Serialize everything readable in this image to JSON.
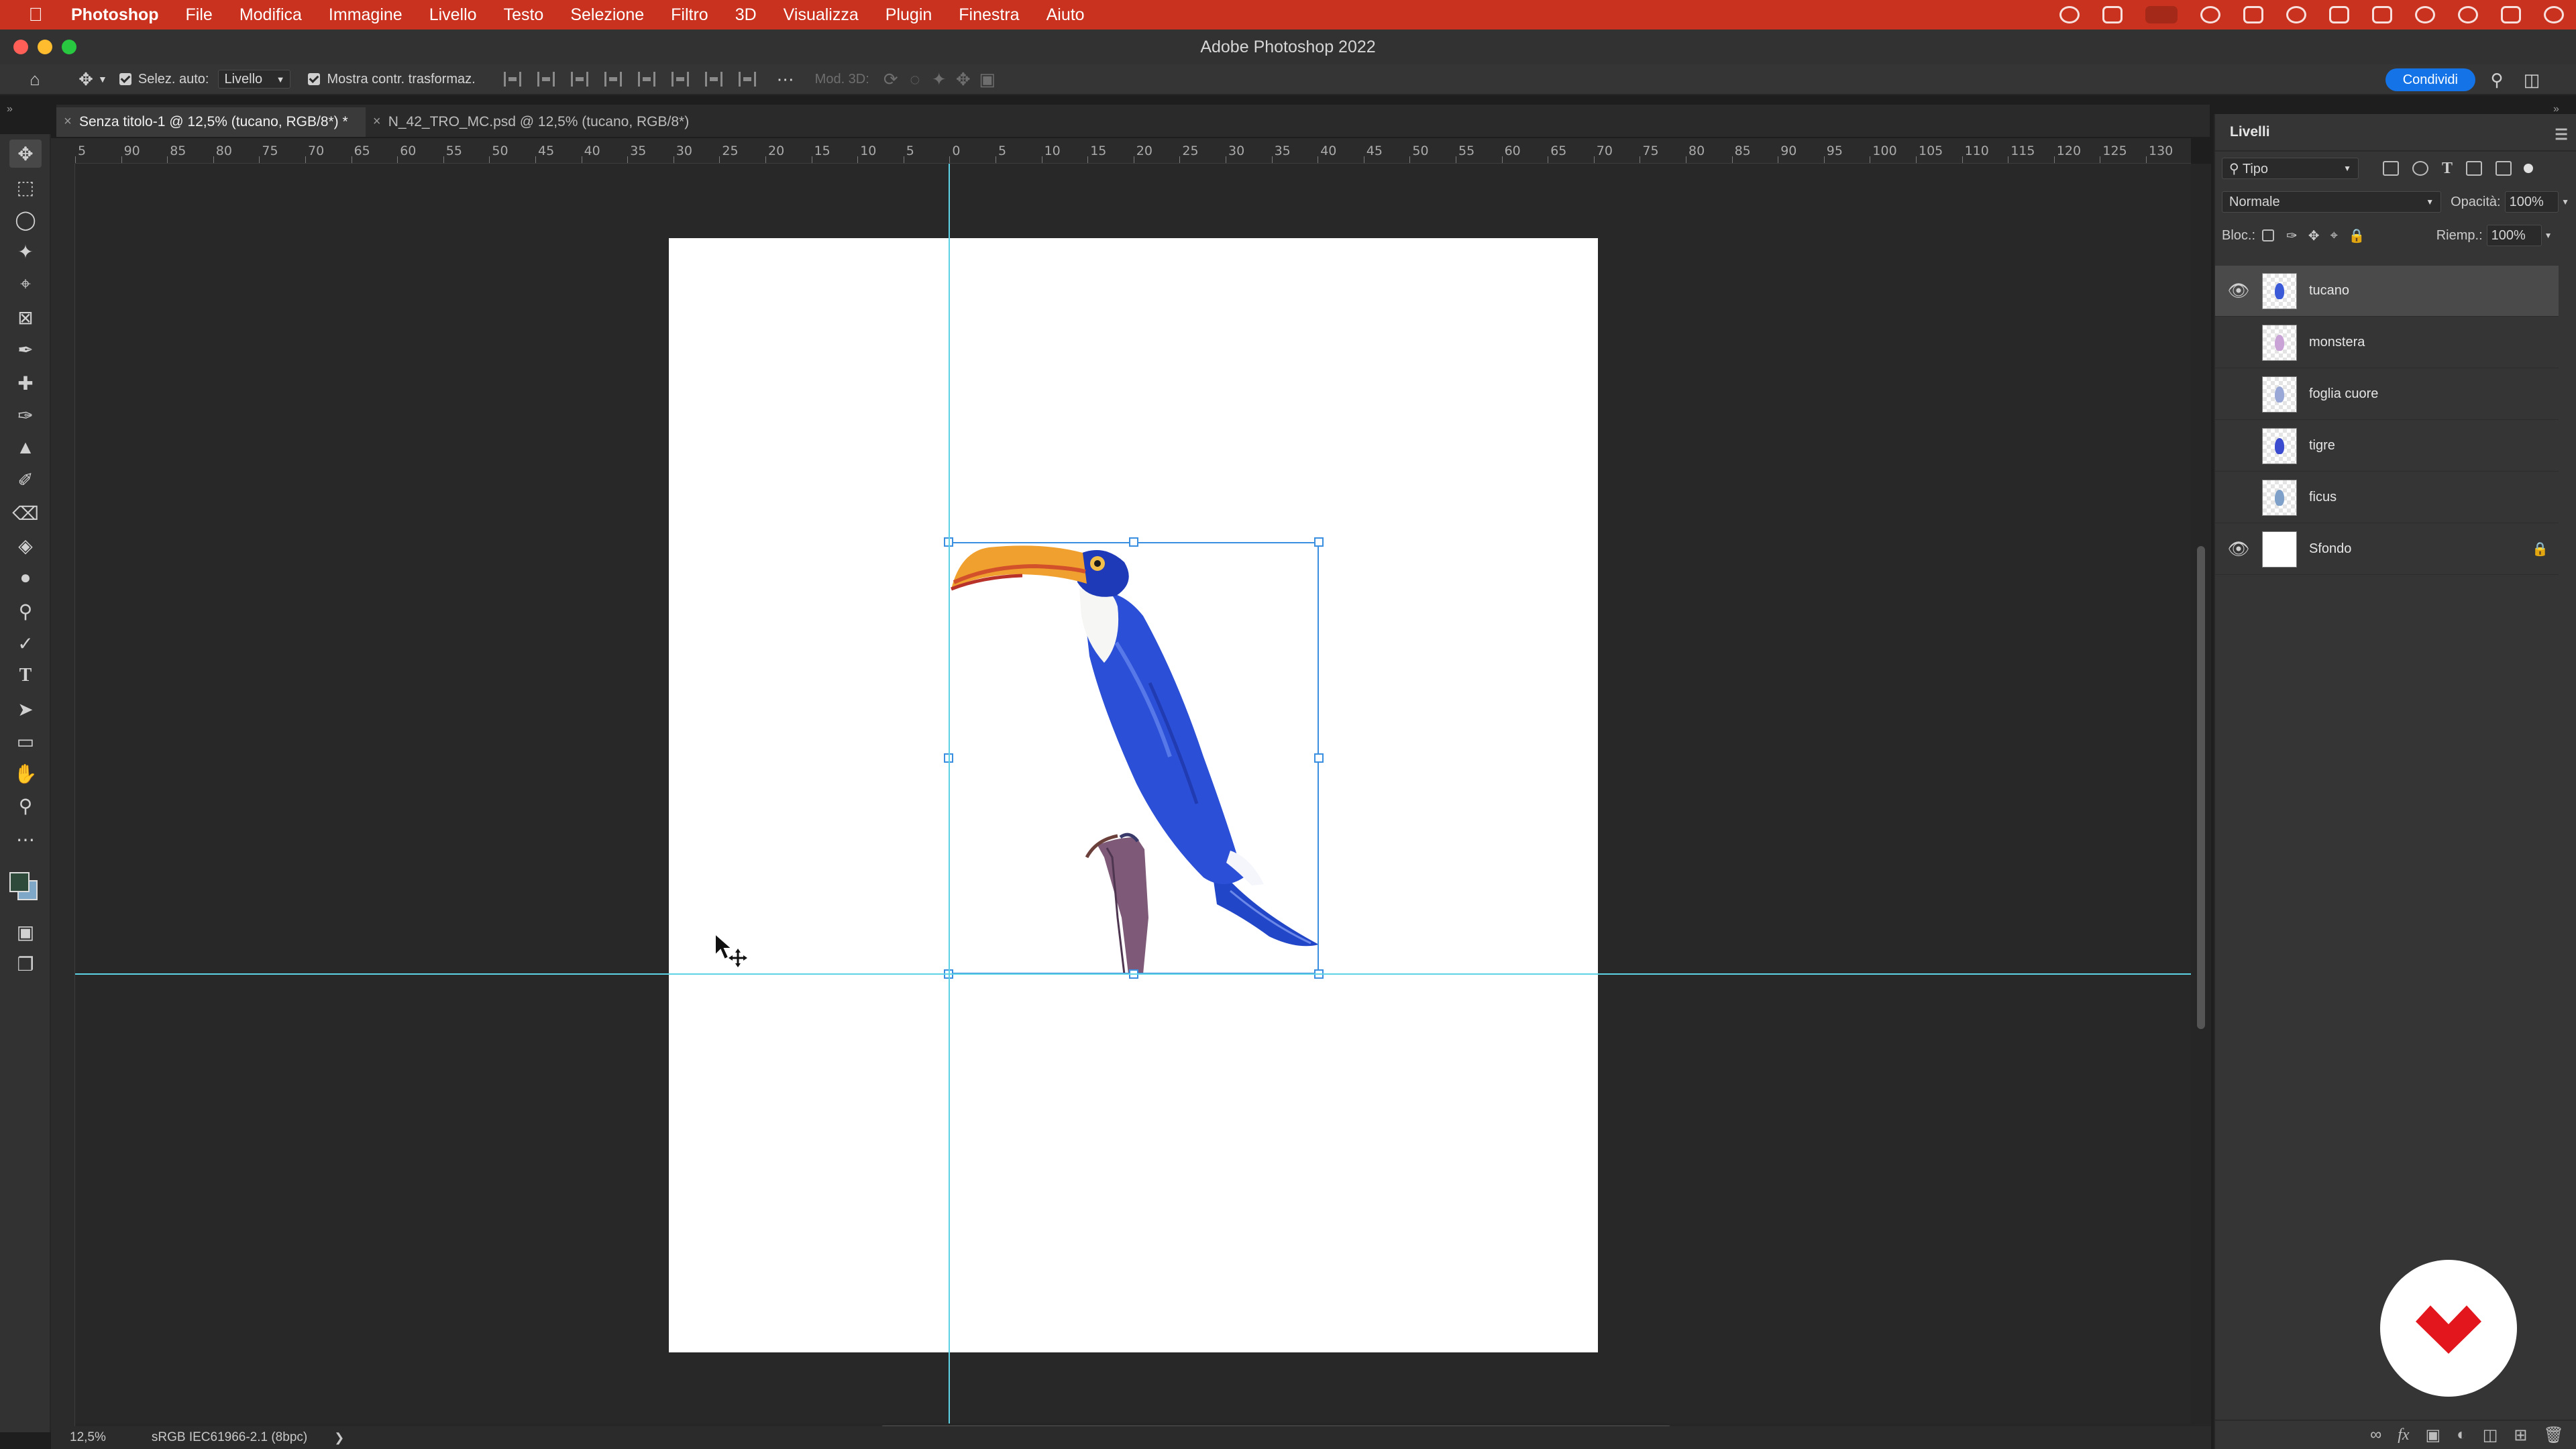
{
  "menubar": {
    "app": "Photoshop",
    "items": [
      "File",
      "Modifica",
      "Immagine",
      "Livello",
      "Testo",
      "Selezione",
      "Filtro",
      "3D",
      "Visualizza",
      "Plugin",
      "Finestra",
      "Aiuto"
    ]
  },
  "window": {
    "title": "Adobe Photoshop 2022"
  },
  "options": {
    "auto_select_label": "Selez. auto:",
    "auto_select_value": "Livello",
    "show_transform_label": "Mostra contr. trasformaz.",
    "mode3d_label": "Mod. 3D:",
    "share_label": "Condividi"
  },
  "doc_tabs": [
    {
      "label": "Senza titolo-1 @ 12,5% (tucano, RGB/8*) *"
    },
    {
      "label": "N_42_TRO_MC.psd @ 12,5% (tucano, RGB/8*)"
    }
  ],
  "ruler": {
    "labels": [
      "5",
      "90",
      "85",
      "80",
      "75",
      "70",
      "65",
      "60",
      "55",
      "50",
      "45",
      "40",
      "35",
      "30",
      "25",
      "20",
      "15",
      "10",
      "5",
      "0",
      "5",
      "10",
      "15",
      "20",
      "25",
      "30",
      "35",
      "40",
      "45",
      "50",
      "55",
      "60",
      "65",
      "70",
      "75",
      "80",
      "85",
      "90",
      "95",
      "100",
      "105",
      "110",
      "115",
      "120",
      "125",
      "130"
    ]
  },
  "status": {
    "zoom": "12,5%",
    "profile": "sRGB IEC61966-2.1 (8bpc)"
  },
  "layers_panel": {
    "title": "Livelli",
    "filter_kind": "Tipo",
    "blend_mode": "Normale",
    "opacity_label": "Opacità:",
    "opacity_value": "100%",
    "lock_label": "Bloc.:",
    "fill_label": "Riemp.:",
    "fill_value": "100%",
    "layers": [
      {
        "name": "tucano",
        "visible": true,
        "selected": true,
        "thumb_color": "#3a5ad8"
      },
      {
        "name": "monstera",
        "visible": false,
        "selected": false,
        "thumb_color": "#c9a3d6"
      },
      {
        "name": "foglia cuore",
        "visible": false,
        "selected": false,
        "thumb_color": "#9aa8d8"
      },
      {
        "name": "tigre",
        "visible": false,
        "selected": false,
        "thumb_color": "#3a4bd0"
      },
      {
        "name": "ficus",
        "visible": false,
        "selected": false,
        "thumb_color": "#7fa0c8"
      },
      {
        "name": "Sfondo",
        "visible": true,
        "selected": false,
        "locked": true,
        "thumb_color": "#ffffff"
      }
    ]
  },
  "colors": {
    "menubar": "#c9321f",
    "guides": "#5fd3e6",
    "transform_box": "#3b8fe0",
    "share_button": "#1473e6"
  }
}
